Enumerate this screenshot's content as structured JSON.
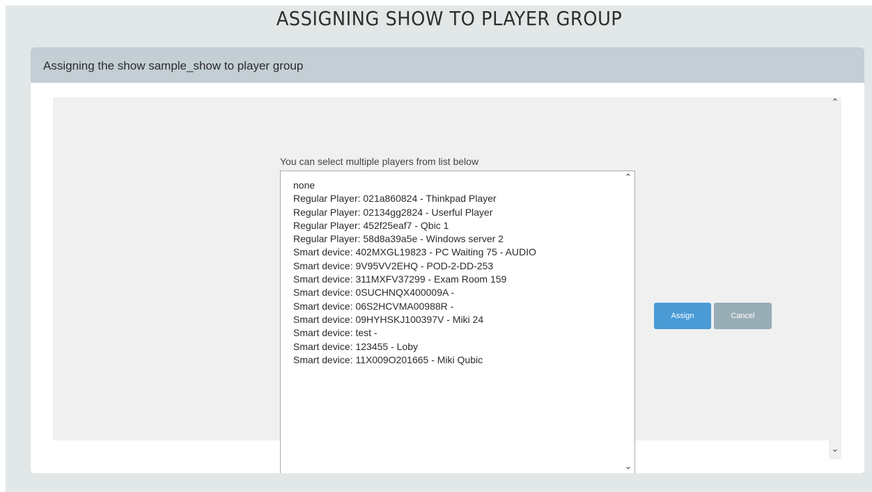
{
  "page": {
    "title": "ASSIGNING SHOW TO PLAYER GROUP"
  },
  "panel": {
    "heading": "Assigning the show sample_show to player group",
    "hint": "You can select multiple players from list below",
    "players": [
      "none",
      "Regular Player: 021a860824 - Thinkpad Player",
      "Regular Player: 02134gg2824 - Userful Player",
      "Regular Player: 452f25eaf7 - Qbic 1",
      "Regular Player: 58d8a39a5e - Windows server 2",
      "Smart device: 402MXGL19823 - PC Waiting 75 - AUDIO",
      "Smart device: 9V95VV2EHQ - POD-2-DD-253",
      "Smart device: 311MXFV37299 - Exam Room 159",
      "Smart device: 0SUCHNQX400009A -",
      "Smart device: 06S2HCVMA00988R -",
      "Smart device: 09HYHSKJ100397V - Miki 24",
      "Smart device: test -",
      "Smart device: 123455 - Loby",
      "Smart device: 11X009O201665 - Miki Qubic"
    ],
    "assign_label": "Assign",
    "cancel_label": "Cancel"
  },
  "icons": {
    "scroll_up": "chevron-up-icon",
    "scroll_down": "chevron-down-icon"
  },
  "colors": {
    "page_bg": "#e2e7e8",
    "header_bg": "#c3cfd5",
    "assign": "#4a9bd6",
    "cancel": "#98adb5"
  }
}
